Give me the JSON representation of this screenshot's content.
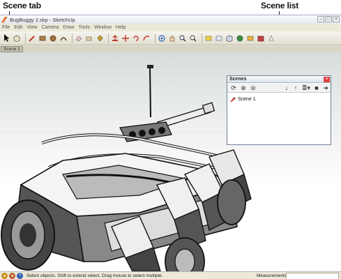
{
  "callouts": {
    "scene_tab": "Scene tab",
    "scene_list": "Scene list"
  },
  "window": {
    "title": "BugBuggy 2.skp - SketchUp"
  },
  "menu": [
    "File",
    "Edit",
    "View",
    "Camera",
    "Draw",
    "Tools",
    "Window",
    "Help"
  ],
  "scene_tabs": [
    "Scene 1"
  ],
  "scenes_panel": {
    "title": "Scenes",
    "scenes": [
      "Scene 1"
    ]
  },
  "status": {
    "hint": "Select objects. Shift to extend select. Drag mouse to select multiple.",
    "measurements_label": "Measurements",
    "measurements_value": ""
  }
}
